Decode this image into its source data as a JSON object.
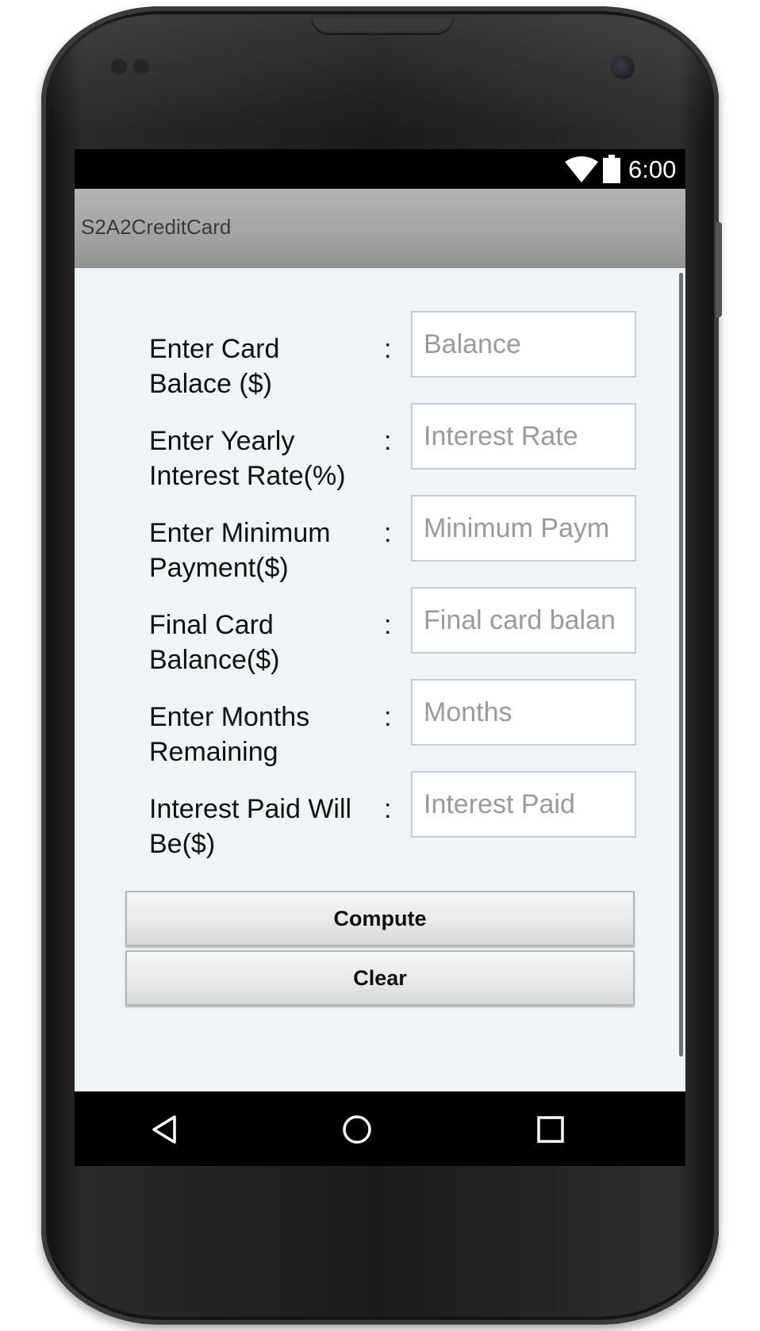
{
  "status_bar": {
    "time": "6:00",
    "wifi_icon": "wifi-icon",
    "battery_icon": "battery-full-icon"
  },
  "action_bar": {
    "title": "S2A2CreditCard"
  },
  "form": {
    "rows": [
      {
        "label": "Enter Card Balace ($)",
        "separator": ":",
        "placeholder": "Balance"
      },
      {
        "label": "Enter Yearly Interest Rate(%)",
        "separator": ":",
        "placeholder": "Interest Rate"
      },
      {
        "label": "Enter Minimum Payment($)",
        "separator": ":",
        "placeholder": "Minimum Paym"
      },
      {
        "label": "Final Card Balance($)",
        "separator": ":",
        "placeholder": "Final card balan"
      },
      {
        "label": "Enter Months Remaining",
        "separator": ":",
        "placeholder": "Months"
      },
      {
        "label": "Interest Paid Will Be($)",
        "separator": ":",
        "placeholder": "Interest Paid"
      }
    ],
    "compute_label": "Compute",
    "clear_label": "Clear"
  },
  "nav_bar": {
    "back_icon": "back-triangle-icon",
    "home_icon": "home-circle-icon",
    "recents_icon": "recents-square-icon"
  },
  "colors": {
    "content_background": "#eff5f6",
    "action_bar": "#a2a2a2",
    "status_bar": "#000000",
    "phone_body": "#1c1c1c"
  }
}
